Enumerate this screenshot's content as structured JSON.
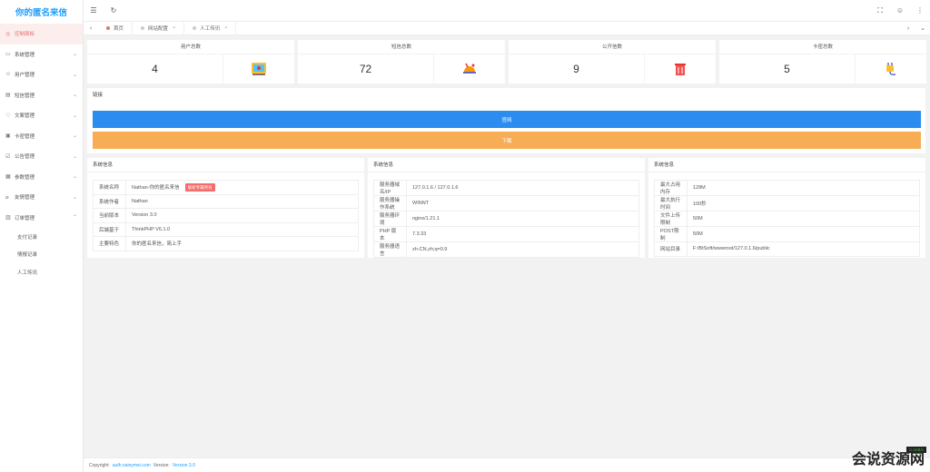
{
  "app": {
    "title": "你的匿名来信"
  },
  "sidebar": {
    "items": [
      {
        "label": "控制面板",
        "icon": "dashboard-icon",
        "active": true
      },
      {
        "label": "系统管理",
        "icon": "monitor-icon"
      },
      {
        "label": "用户管理",
        "icon": "user-icon"
      },
      {
        "label": "短信管理",
        "icon": "message-icon"
      },
      {
        "label": "文案管理",
        "icon": "heart-icon"
      },
      {
        "label": "卡密管理",
        "icon": "card-icon"
      },
      {
        "label": "公告管理",
        "icon": "notice-icon"
      },
      {
        "label": "参数管理",
        "icon": "grid-icon"
      },
      {
        "label": "友情管理",
        "icon": "link-icon"
      },
      {
        "label": "订单管理",
        "icon": "order-icon",
        "expanded": true
      }
    ],
    "sub_items": [
      {
        "label": "支付记录"
      },
      {
        "label": "情报记录"
      },
      {
        "label": "人工传讯"
      }
    ]
  },
  "tabs": [
    {
      "label": "首页"
    },
    {
      "label": "网站配置"
    },
    {
      "label": "人工传讯"
    }
  ],
  "stats": [
    {
      "title": "用户总数",
      "value": "4",
      "icon": "user-count-icon"
    },
    {
      "title": "短信总数",
      "value": "72",
      "icon": "sms-count-icon"
    },
    {
      "title": "公开信数",
      "value": "9",
      "icon": "trash-icon"
    },
    {
      "title": "卡密总数",
      "value": "5",
      "icon": "plug-icon"
    }
  ],
  "links": {
    "title": "链接",
    "buttons": [
      {
        "label": "官网",
        "color": "#2d8cf0"
      },
      {
        "label": "下载",
        "color": "#f7ad55"
      }
    ]
  },
  "panels": [
    {
      "title": "系统信息",
      "rows": [
        {
          "k": "系统名称",
          "v": "Nathan-你的匿名来信",
          "badge": "版权专属所有"
        },
        {
          "k": "系统作者",
          "v": "Nathan"
        },
        {
          "k": "当前版本",
          "v": "Version 3.0"
        },
        {
          "k": "后端基于",
          "v": "ThinkPHP V6.1.0"
        },
        {
          "k": "主要特色",
          "v": "你的匿名来信，简上手"
        }
      ]
    },
    {
      "title": "系统信息",
      "rows": [
        {
          "k": "服务器域名/IP",
          "v": "127.0.1.6 / 127.0.1.6"
        },
        {
          "k": "服务器操作系统",
          "v": "WINNT"
        },
        {
          "k": "服务器环境",
          "v": "nginx/1.21.1"
        },
        {
          "k": "PHP 版本",
          "v": "7.3.33"
        },
        {
          "k": "服务器语言",
          "v": "zh-CN,zh;q=0.9"
        }
      ]
    },
    {
      "title": "系统信息",
      "rows": [
        {
          "k": "最大占用内存",
          "v": "128M"
        },
        {
          "k": "最大执行时间",
          "v": "100秒"
        },
        {
          "k": "文件上传限制",
          "v": "50M"
        },
        {
          "k": "POST限制",
          "v": "50M"
        },
        {
          "k": "网站目录",
          "v": "F:/BtSoft/wwwroot/127.0.1.6/public"
        }
      ]
    }
  ],
  "footer": {
    "prefix": "Copyright",
    "link": "auth.nainymei.com",
    "version_label": "Version:",
    "version": "Version 3.0"
  },
  "watermark": {
    "text": "会说资源网",
    "badge": "0.1KB/s"
  },
  "colors": {
    "accent": "#1E9FFF",
    "primary_btn": "#2d8cf0",
    "warn_btn": "#f7ad55",
    "danger": "#f56c6c"
  }
}
